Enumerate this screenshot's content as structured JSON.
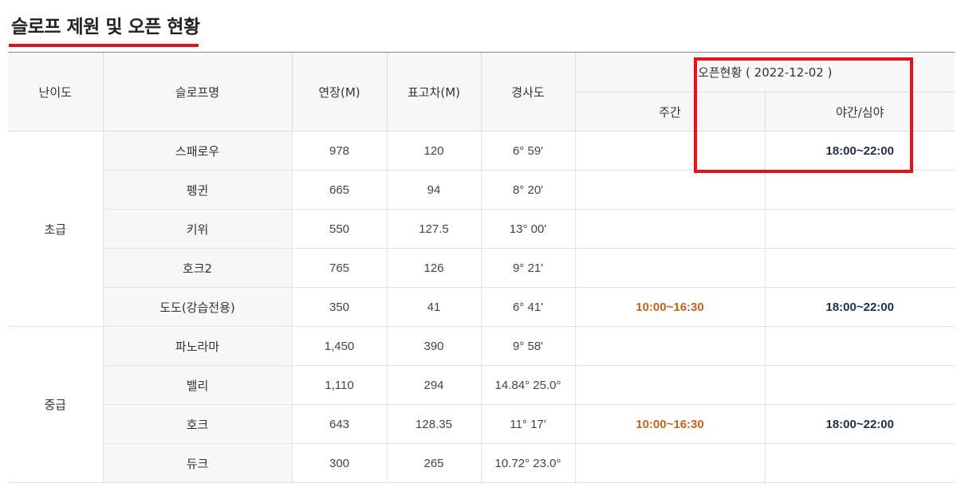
{
  "title": "슬로프 제원 및 오픈 현황",
  "headers": {
    "level": "난이도",
    "slope": "슬로프명",
    "length": "연장(M)",
    "elevation": "표고차(M)",
    "gradient": "경사도",
    "open_status": "오픈현황 ( 2022-12-02 )",
    "day": "주간",
    "night": "야간/심야"
  },
  "groups": [
    {
      "level": "초급",
      "rows": [
        {
          "name": "스패로우",
          "length": "978",
          "elevation": "120",
          "gradient": "6° 59'",
          "day": "",
          "night": "18:00~22:00"
        },
        {
          "name": "펭귄",
          "length": "665",
          "elevation": "94",
          "gradient": "8° 20'",
          "day": "",
          "night": ""
        },
        {
          "name": "키위",
          "length": "550",
          "elevation": "127.5",
          "gradient": "13° 00'",
          "day": "",
          "night": ""
        },
        {
          "name": "호크2",
          "length": "765",
          "elevation": "126",
          "gradient": "9° 21'",
          "day": "",
          "night": ""
        },
        {
          "name": "도도(강습전용)",
          "length": "350",
          "elevation": "41",
          "gradient": "6° 41'",
          "day": "10:00~16:30",
          "night": "18:00~22:00"
        }
      ]
    },
    {
      "level": "중급",
      "rows": [
        {
          "name": "파노라마",
          "length": "1,450",
          "elevation": "390",
          "gradient": "9° 58'",
          "day": "",
          "night": ""
        },
        {
          "name": "밸리",
          "length": "1,110",
          "elevation": "294",
          "gradient": "14.84° 25.0°",
          "day": "",
          "night": ""
        },
        {
          "name": "호크",
          "length": "643",
          "elevation": "128.35",
          "gradient": "11° 17'",
          "day": "10:00~16:30",
          "night": "18:00~22:00"
        },
        {
          "name": "듀크",
          "length": "300",
          "elevation": "265",
          "gradient": "10.72° 23.0°",
          "day": "",
          "night": ""
        }
      ]
    }
  ],
  "colors": {
    "accent_red": "#e2131d",
    "day_time": "#c4621a",
    "night_time": "#1e2f4a"
  }
}
